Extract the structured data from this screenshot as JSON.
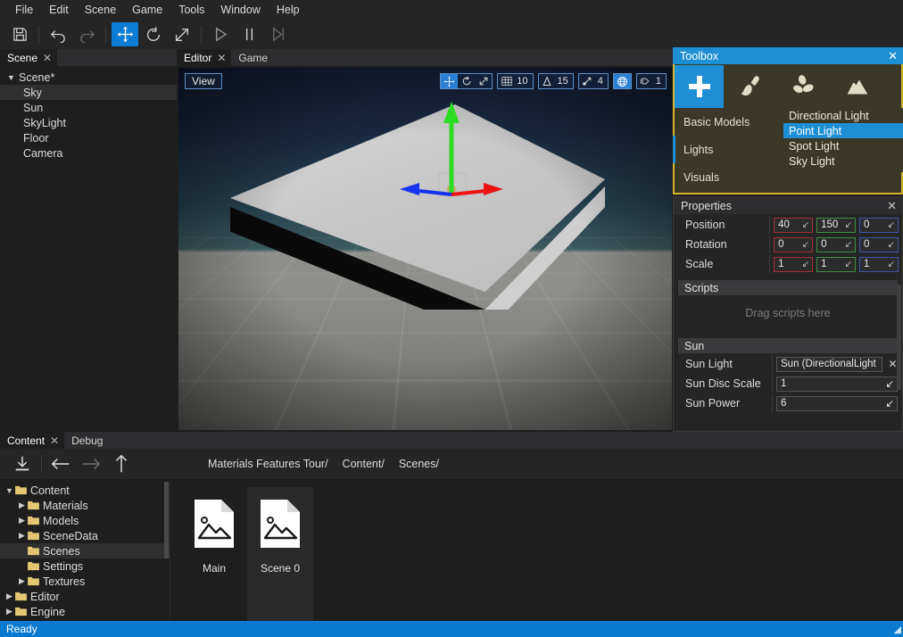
{
  "menubar": {
    "items": [
      {
        "label": "File"
      },
      {
        "label": "Edit"
      },
      {
        "label": "Scene"
      },
      {
        "label": "Game"
      },
      {
        "label": "Tools"
      },
      {
        "label": "Window"
      },
      {
        "label": "Help"
      }
    ]
  },
  "toolbar": {
    "buttons": [
      {
        "name": "save-icon",
        "label": "Save"
      },
      {
        "name": "undo-icon",
        "label": "Undo"
      },
      {
        "name": "redo-icon",
        "label": "Redo"
      },
      {
        "name": "translate-gizmo-icon",
        "label": "Translate"
      },
      {
        "name": "rotate-gizmo-icon",
        "label": "Rotate"
      },
      {
        "name": "scale-gizmo-icon",
        "label": "Scale"
      },
      {
        "name": "play-icon",
        "label": "Play"
      },
      {
        "name": "pause-icon",
        "label": "Pause"
      },
      {
        "name": "step-icon",
        "label": "Step"
      }
    ]
  },
  "scene_panel": {
    "tabs": [
      {
        "label": "Scene",
        "selected": true,
        "closable": true
      }
    ],
    "tree": [
      {
        "label": "Scene*",
        "depth": 0,
        "expanded": true,
        "selected": false
      },
      {
        "label": "Sky",
        "depth": 1,
        "selected": true
      },
      {
        "label": "Sun",
        "depth": 1,
        "selected": false
      },
      {
        "label": "SkyLight",
        "depth": 1,
        "selected": false
      },
      {
        "label": "Floor",
        "depth": 1,
        "selected": false
      },
      {
        "label": "Camera",
        "depth": 1,
        "selected": false
      }
    ]
  },
  "viewport": {
    "tabs": [
      {
        "label": "Editor",
        "selected": true,
        "closable": true
      },
      {
        "label": "Game",
        "selected": false,
        "closable": false
      }
    ],
    "view_button": "View",
    "tools": {
      "grid_snap": "10",
      "angle_snap": "15",
      "scale_snap": "4",
      "speed": "1"
    }
  },
  "toolbox": {
    "title": "Toolbox",
    "close": "✕",
    "tabs": [
      {
        "name": "add-icon",
        "label": "Add",
        "selected": true
      },
      {
        "name": "paint-brush-icon",
        "label": "Paint",
        "selected": false
      },
      {
        "name": "foliage-icon",
        "label": "Foliage",
        "selected": false
      },
      {
        "name": "terrain-icon",
        "label": "Terrain",
        "selected": false
      }
    ],
    "categories": [
      {
        "label": "Basic Models",
        "selected": false
      },
      {
        "label": "Lights",
        "selected": true
      },
      {
        "label": "Visuals",
        "selected": false
      }
    ],
    "submenu": [
      {
        "label": "Directional Light",
        "selected": false
      },
      {
        "label": "Point Light",
        "selected": true
      },
      {
        "label": "Spot Light",
        "selected": false
      },
      {
        "label": "Sky Light",
        "selected": false
      }
    ],
    "accent_border": "#d8b42a",
    "accent_blue": "#1e8fd5"
  },
  "properties": {
    "title": "Properties",
    "close": "✕",
    "transform": [
      {
        "label": "Position",
        "x": "40",
        "y": "150",
        "z": "0"
      },
      {
        "label": "Rotation",
        "x": "0",
        "y": "0",
        "z": "0"
      },
      {
        "label": "Scale",
        "x": "1",
        "y": "1",
        "z": "1"
      }
    ],
    "scripts": {
      "header": "Scripts",
      "hint": "Drag scripts here"
    },
    "sun": {
      "header": "Sun",
      "fields": [
        {
          "label": "Sun Light",
          "value": "Sun (DirectionalLight",
          "clearable": true
        },
        {
          "label": "Sun Disc Scale",
          "value": "1",
          "clearable": false
        },
        {
          "label": "Sun Power",
          "value": "6",
          "clearable": false
        }
      ]
    },
    "axis_colors": {
      "x": "#9e3030",
      "y": "#3f8b3f",
      "z": "#3a56a8"
    }
  },
  "content_browser": {
    "tabs": [
      {
        "label": "Content",
        "selected": true,
        "closable": true
      },
      {
        "label": "Debug",
        "selected": false,
        "closable": false
      }
    ],
    "toolbar_buttons": [
      {
        "name": "import-icon",
        "label": "Import"
      },
      {
        "name": "back-arrow-icon",
        "label": "Back"
      },
      {
        "name": "forward-arrow-icon",
        "label": "Forward"
      },
      {
        "name": "up-arrow-icon",
        "label": "Up"
      }
    ],
    "breadcrumb": [
      "Materials Features Tour/",
      "Content/",
      "Scenes/"
    ],
    "tree": [
      {
        "label": "Content",
        "depth": 0,
        "expanded": true,
        "arrow": "down",
        "selected": false
      },
      {
        "label": "Materials",
        "depth": 1,
        "arrow": "right",
        "selected": false
      },
      {
        "label": "Models",
        "depth": 1,
        "arrow": "right",
        "selected": false
      },
      {
        "label": "SceneData",
        "depth": 1,
        "arrow": "right",
        "selected": false
      },
      {
        "label": "Scenes",
        "depth": 1,
        "arrow": "none",
        "selected": true
      },
      {
        "label": "Settings",
        "depth": 1,
        "arrow": "none",
        "selected": false
      },
      {
        "label": "Textures",
        "depth": 1,
        "arrow": "right",
        "selected": false
      },
      {
        "label": "Editor",
        "depth": 0,
        "arrow": "right",
        "selected": false
      },
      {
        "label": "Engine",
        "depth": 0,
        "arrow": "right",
        "selected": false
      }
    ],
    "assets": [
      {
        "name": "Main",
        "icon": "scene-asset-icon",
        "highlighted": false
      },
      {
        "name": "Scene 0",
        "icon": "scene-asset-icon",
        "highlighted": true
      }
    ]
  },
  "statusbar": {
    "text": "Ready"
  }
}
